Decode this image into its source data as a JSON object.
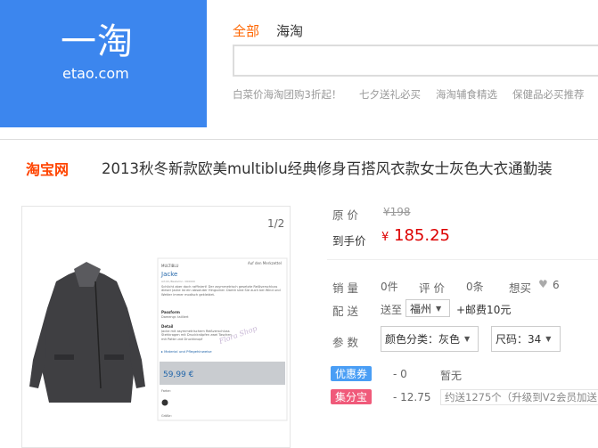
{
  "header": {
    "logo_mark": "一淘",
    "logo_text": "etao.com",
    "tabs": [
      "全部",
      "海淘"
    ],
    "search_value": "",
    "hot_words": [
      "白菜价海淘团购3折起！",
      "七夕送礼必买",
      "海淘辅食精选",
      "保健品必买推荐"
    ]
  },
  "product": {
    "store_logo": "淘宝网",
    "title": "2013秋冬新款欧美multiblu经典修身百搭风衣款女士灰色大衣通勤装",
    "image_counter": "1/2",
    "image": {
      "header_note": "Auf den Merkzettel",
      "brand": "MULTIBLU",
      "name": "Jacke",
      "art": "Art.Nr./Bestellnr.: 000000",
      "desc": "Schlicht aber doch raffiniert! Der asymmetrisch gesetzte Reißverschluss dieser Jacke ist ein absoluter Hingucker. Damit sind Sie auch bei Wind und Wetter immer modisch gekleidet.",
      "fit_title": "Passform",
      "fit_text": "Damengr. tailliert",
      "detail_title": "Detail",
      "detail_text": "Jacke mit asymmetrischem Reißverschluss Stehkragen mit Druckknöpfen zwei Taschen mit Patte und Druckknopf",
      "material_link": "▸ Material und Pflegehinweise",
      "price": "59,99 €",
      "farbe": "Farbe:",
      "groesse": "Größe:",
      "watermark": "Flora Shop"
    },
    "orig_price_label": "原  价",
    "orig_price": "¥198",
    "final_price_label": "到手价",
    "currency": "¥",
    "final_price": "185.25",
    "sales_label": "销  量",
    "sales": "0件",
    "reviews_label": "评  价",
    "reviews": "0条",
    "want_label": "想买",
    "want_count": "6",
    "delivery_label": "配  送",
    "delivery_to": "送至",
    "city": "福州",
    "shipping": "+邮费10元",
    "params_label": "参  数",
    "color_select": "颜色分类：灰色",
    "size_select": "尺码：34",
    "coupon_tag": "优惠券",
    "coupon_value": "- 0",
    "coupon_note": "暂无",
    "jfb_tag": "集分宝",
    "jfb_value": "- 12.75",
    "jfb_note": "约送1275个（升级到V2会员加送"
  },
  "colors": {
    "brand_blue": "#3c86ee",
    "orange": "#ff6600",
    "price_red": "#dd0000",
    "coupon_blue": "#4a9ef5",
    "jfb_pink": "#f05a7a"
  }
}
